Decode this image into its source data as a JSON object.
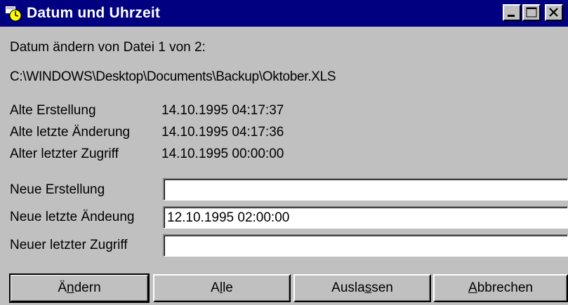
{
  "window": {
    "title": "Datum und Uhrzeit",
    "controls": {
      "minimize": "minimize-icon",
      "maximize": "maximize-icon",
      "close": "close-icon"
    }
  },
  "info": {
    "change_line": "Datum ändern von Datei 1 von 2:",
    "file_path": "C:\\WINDOWS\\Desktop\\Documents\\Backup\\Oktober.XLS"
  },
  "old_values": [
    {
      "label": "Alte Erstellung",
      "value": "14.10.1995 04:17:37"
    },
    {
      "label": "Alte letzte Änderung",
      "value": "14.10.1995 04:17:36"
    },
    {
      "label": "Alter letzter Zugriff",
      "value": "14.10.1995 00:00:00"
    }
  ],
  "new_values": [
    {
      "label": "Neue Erstellung",
      "value": ""
    },
    {
      "label": "Neue letzte Ändeung",
      "value": "12.10.1995 02:00:00"
    },
    {
      "label": "Neuer letzter Zugriff",
      "value": ""
    }
  ],
  "buttons": {
    "aendern": {
      "pre": "Ä",
      "accel": "n",
      "post": "dern"
    },
    "alle": {
      "pre": "A",
      "accel": "l",
      "post": "le"
    },
    "auslassen": {
      "pre": "Ausla",
      "accel": "s",
      "post": "sen"
    },
    "abbrechen": {
      "pre": "",
      "accel": "A",
      "post": "bbrechen"
    }
  }
}
